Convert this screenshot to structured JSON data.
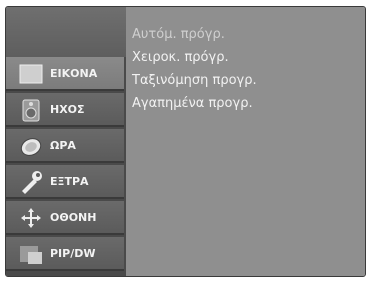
{
  "sidebar": {
    "items": [
      {
        "label": "ΕΙΚΟΝΑ",
        "icon": "picture-icon"
      },
      {
        "label": "ΗΧΟΣ",
        "icon": "speaker-icon"
      },
      {
        "label": "ΩΡΑ",
        "icon": "clock-icon"
      },
      {
        "label": "ΕΞΤΡΑ",
        "icon": "extras-icon"
      },
      {
        "label": "ΟΘΟΝΗ",
        "icon": "screen-move-icon"
      },
      {
        "label": "PIP/DW",
        "icon": "pip-icon"
      }
    ],
    "active_index": 0
  },
  "submenu": {
    "options": [
      {
        "label": "Αυτόμ. πρόγρ."
      },
      {
        "label": "Χειροκ. πρόγρ."
      },
      {
        "label": "Ταξινόμηση προγρ."
      },
      {
        "label": "Αγαπημένα προγρ."
      }
    ]
  }
}
